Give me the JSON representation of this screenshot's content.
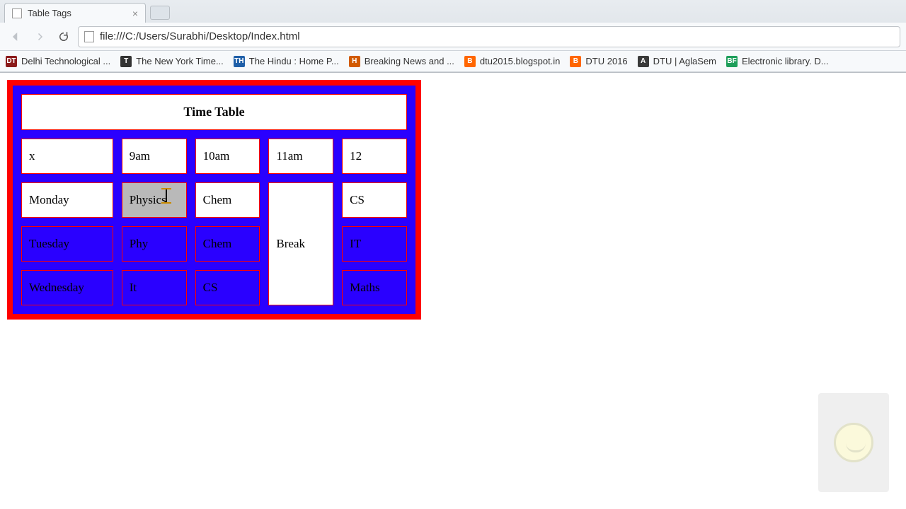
{
  "browser": {
    "tab_title": "Table Tags",
    "url": "file:///C:/Users/Surabhi/Desktop/Index.html",
    "bookmarks": [
      {
        "label": "Delhi Technological ...",
        "color": "#8b1a1a",
        "initial": "DT"
      },
      {
        "label": "The New York Time...",
        "color": "#333333",
        "initial": "T"
      },
      {
        "label": "The Hindu : Home P...",
        "color": "#1f5fa8",
        "initial": "TH"
      },
      {
        "label": "Breaking News and ...",
        "color": "#d25a00",
        "initial": "H"
      },
      {
        "label": "dtu2015.blogspot.in",
        "color": "#ff6600",
        "initial": "B"
      },
      {
        "label": "DTU 2016",
        "color": "#ff6600",
        "initial": "B"
      },
      {
        "label": "DTU | AglaSem",
        "color": "#3a3a3a",
        "initial": "A"
      },
      {
        "label": "Electronic library. D...",
        "color": "#1e9e5a",
        "initial": "BF"
      }
    ]
  },
  "table": {
    "caption": "Time Table",
    "headers": [
      "x",
      "9am",
      "10am",
      "11am",
      "12"
    ],
    "rows": [
      {
        "day": "Monday",
        "c1": "Physics",
        "c2": "Chem",
        "c4": "CS"
      },
      {
        "day": "Tuesday",
        "c1": "Phy",
        "c2": "Chem",
        "c4": "IT"
      },
      {
        "day": "Wednesday",
        "c1": "It",
        "c2": "CS",
        "c4": "Maths"
      }
    ],
    "break_label": "Break"
  }
}
